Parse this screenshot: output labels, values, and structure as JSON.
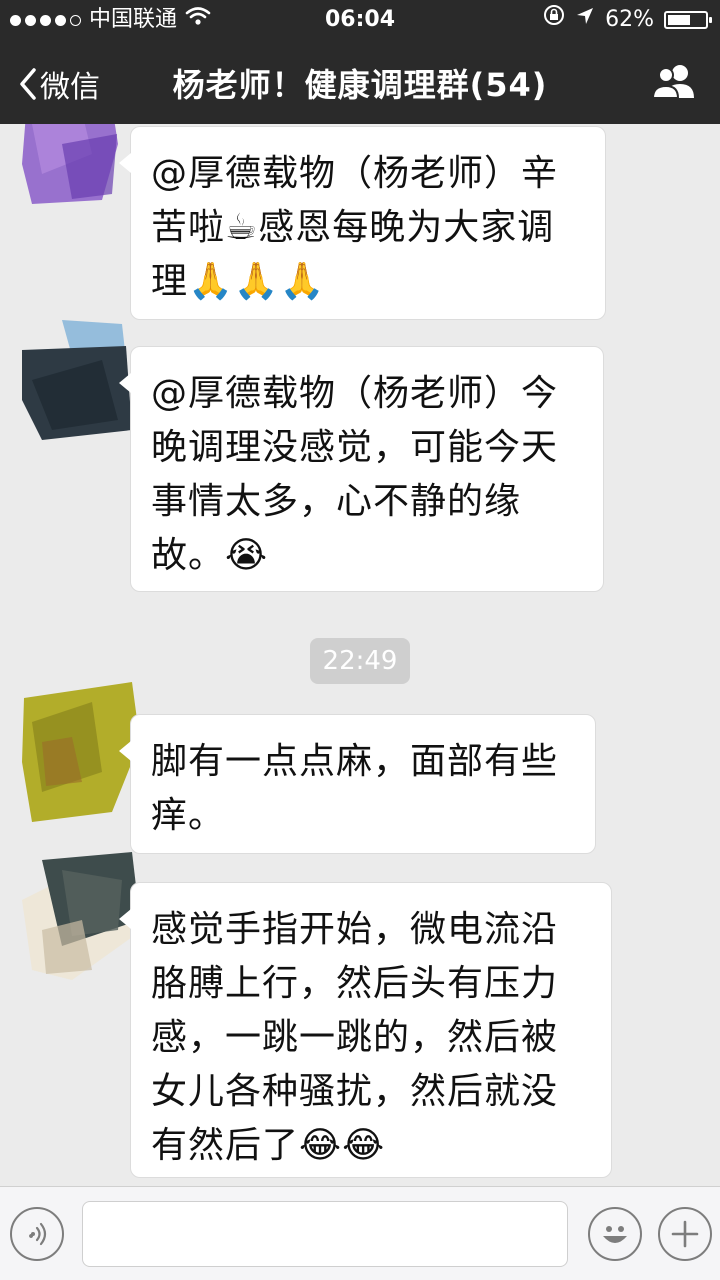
{
  "status": {
    "carrier": "中国联通",
    "time": "06:04",
    "battery": "62%",
    "battery_level": 0.62
  },
  "nav": {
    "back_label": "微信",
    "title": "杨老师！健康调理群(54)"
  },
  "messages": [
    {
      "text": "@厚德载物（杨老师）辛苦啦☕感恩每晚为大家调理🙏🙏🙏",
      "avatar_color": "#8a5cc9"
    },
    {
      "text": "@厚德载物（杨老师）今晚调理没感觉，可能今天事情太多，心不静的缘故。😭",
      "avatar_color": "#2e3a44"
    },
    {
      "text": "脚有一点点麻，面部有些痒。",
      "avatar_color": "#b2ad2a"
    },
    {
      "text": "感觉手指开始，微电流沿胳膊上行，然后头有压力感，一跳一跳的，然后被女儿各种骚扰，然后就没有然后了😂😂",
      "avatar_color": "#3e4c4c"
    }
  ],
  "timestamp": "22:49",
  "colors": {
    "nav_bg": "#2a2a2a",
    "chat_bg": "#ebebeb",
    "bubble_bg": "#ffffff",
    "timestamp_bg": "#cfcfcf"
  },
  "icons": [
    "wifi-icon",
    "lock-rotation-icon",
    "location-icon",
    "battery-icon",
    "back-chevron-icon",
    "group-members-icon",
    "voice-icon",
    "emoji-icon",
    "plus-icon"
  ]
}
